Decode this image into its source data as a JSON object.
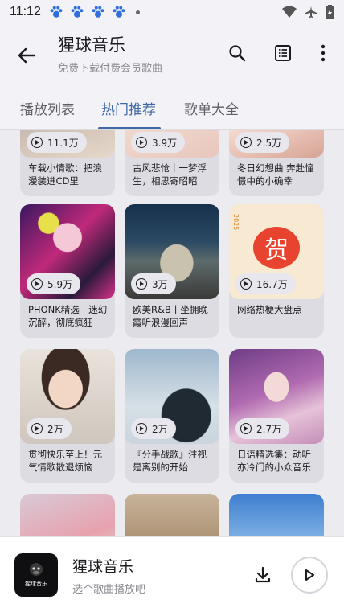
{
  "status_bar": {
    "time": "11:12"
  },
  "app_bar": {
    "title": "猩球音乐",
    "subtitle": "免费下载付费会员歌曲"
  },
  "tabs": [
    {
      "label": "播放列表",
      "active": false
    },
    {
      "label": "热门推荐",
      "active": true
    },
    {
      "label": "歌单大全",
      "active": false
    }
  ],
  "playlists": [
    {
      "count": "11.1万",
      "title": "车载小情歌：把浪漫装进CD里"
    },
    {
      "count": "3.9万",
      "title": "古风悲怆丨一梦浮生，相思寄昭昭"
    },
    {
      "count": "2.5万",
      "title": "冬日幻想曲 奔赴憧憬中的小确幸"
    },
    {
      "count": "5.9万",
      "title": "PHONK精选丨迷幻沉醉，彻底疯狂"
    },
    {
      "count": "3万",
      "title": "欧美R&B丨坐拥晚霞听浪漫回声"
    },
    {
      "count": "16.7万",
      "title": "网络热梗大盘点"
    },
    {
      "count": "2万",
      "title": "贯彻快乐至上！元气情歌散退烦恼"
    },
    {
      "count": "2万",
      "title": "『分手战歌』注视是离别的开始"
    },
    {
      "count": "2.7万",
      "title": "日语精选集：动听亦冷门的小众音乐"
    }
  ],
  "cover_texts": {
    "greeting_char": "贺",
    "cover_year": "2025",
    "player_logo": "猩球音乐"
  },
  "player": {
    "title": "猩球音乐",
    "subtitle": "选个歌曲播放吧"
  },
  "colors": {
    "accent": "#3d6aa6",
    "card_bg": "#dcdce2",
    "page_bg": "#ececf0"
  }
}
